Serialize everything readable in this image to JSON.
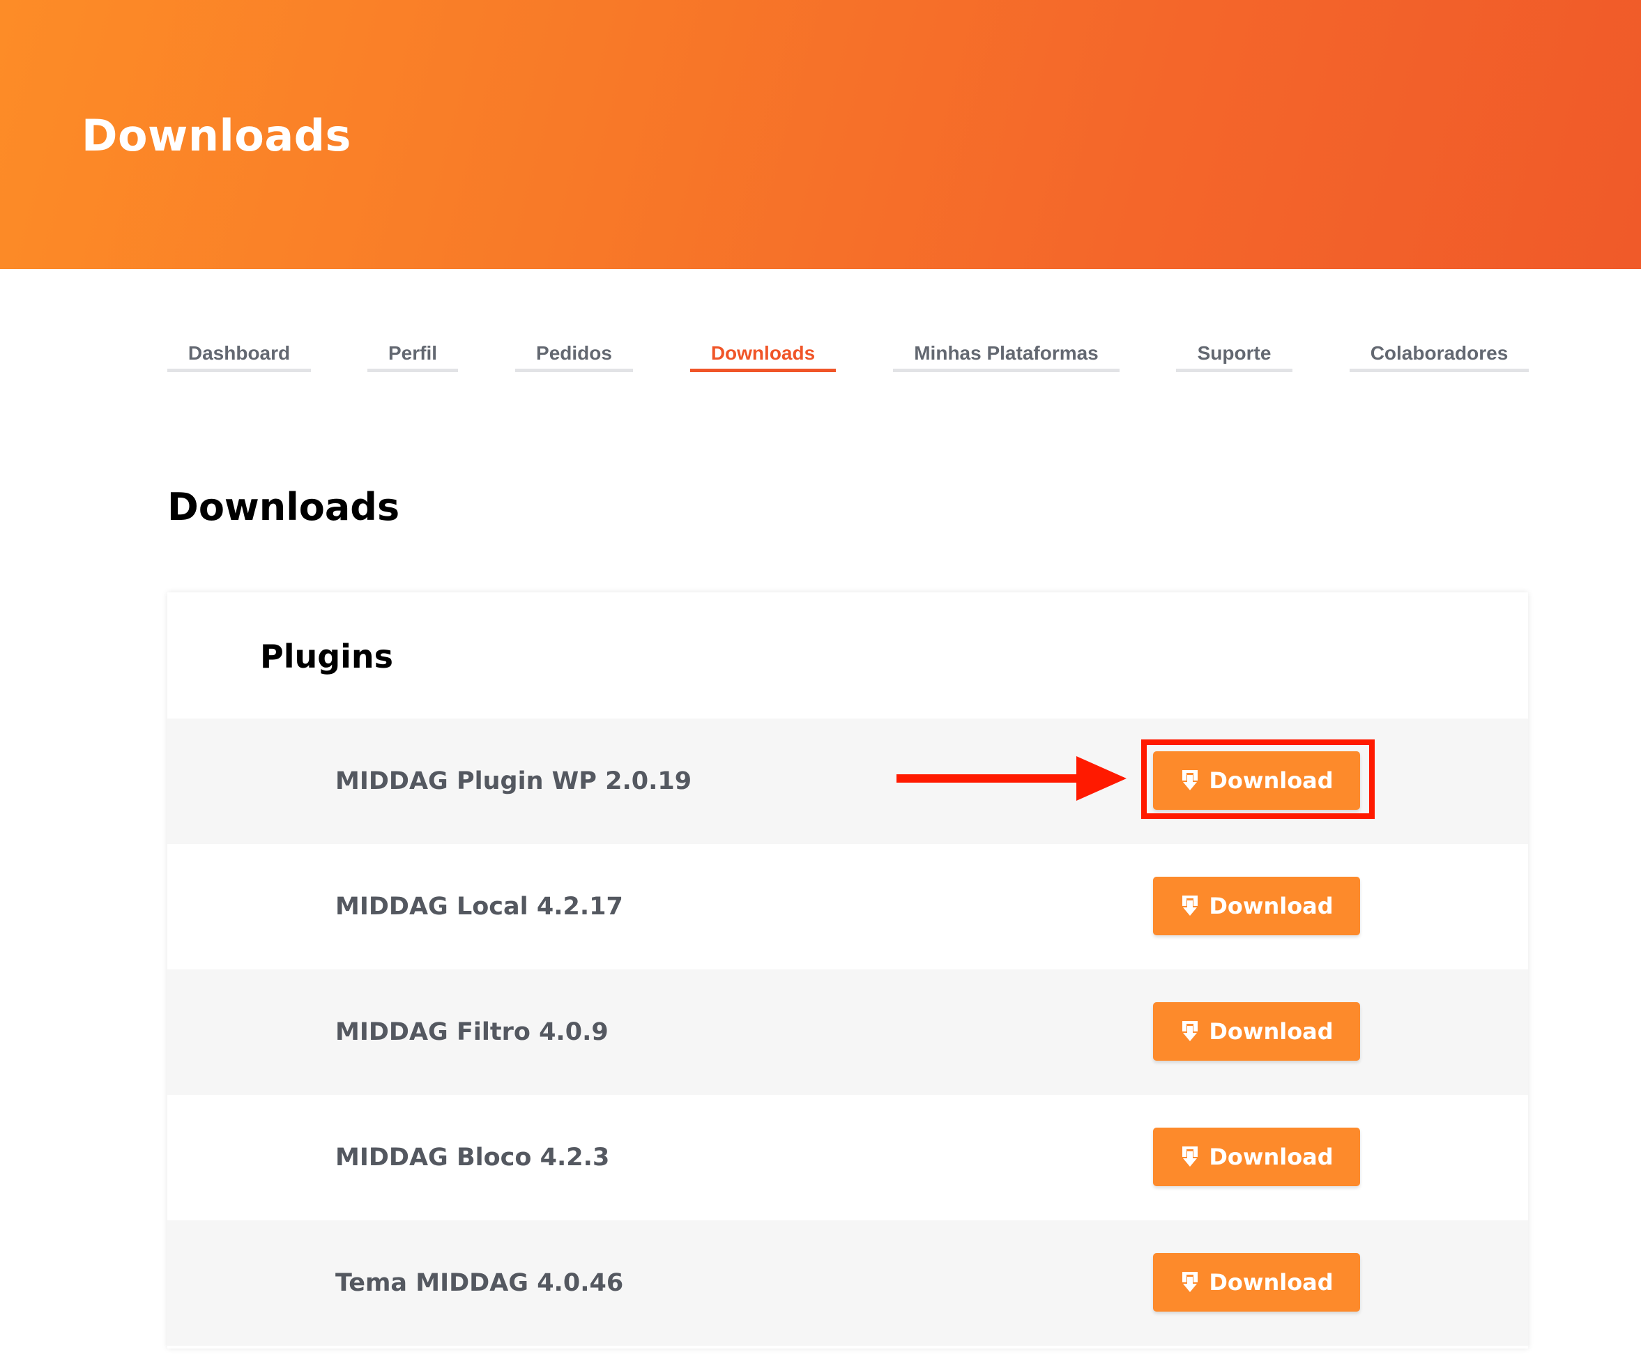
{
  "header": {
    "title": "Downloads"
  },
  "tabs": [
    {
      "label": "Dashboard",
      "active": false
    },
    {
      "label": "Perfil",
      "active": false
    },
    {
      "label": "Pedidos",
      "active": false
    },
    {
      "label": "Downloads",
      "active": true
    },
    {
      "label": "Minhas Plataformas",
      "active": false
    },
    {
      "label": "Suporte",
      "active": false
    },
    {
      "label": "Colaboradores",
      "active": false
    }
  ],
  "main": {
    "title": "Downloads",
    "card": {
      "title": "Plugins",
      "items": [
        {
          "name": "MIDDAG Plugin WP 2.0.19",
          "button_label": "Download"
        },
        {
          "name": "MIDDAG Local 4.2.17",
          "button_label": "Download"
        },
        {
          "name": "MIDDAG Filtro 4.0.9",
          "button_label": "Download"
        },
        {
          "name": "MIDDAG Bloco 4.2.3",
          "button_label": "Download"
        },
        {
          "name": "Tema MIDDAG 4.0.46",
          "button_label": "Download"
        }
      ]
    }
  },
  "annotation": {
    "highlighted_item": "MIDDAG Plugin WP 2.0.19",
    "color": "#ff1a00"
  },
  "colors": {
    "accent": "#f05528",
    "button": "#fd8a2b",
    "header_gradient_start": "#fd8c27",
    "header_gradient_end": "#f05a29"
  },
  "icons": {
    "download_button_icon": "download-icon"
  }
}
